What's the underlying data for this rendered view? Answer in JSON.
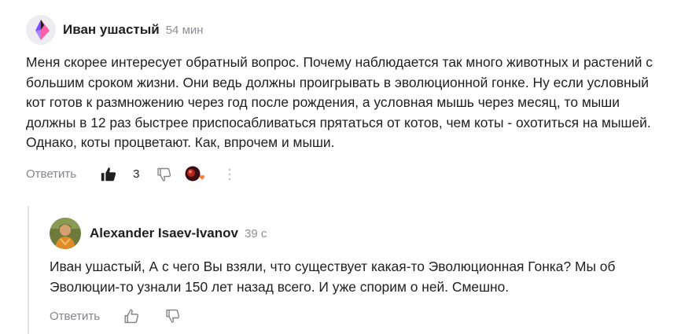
{
  "comment": {
    "author": "Иван ушастый",
    "time": "54 мин",
    "text": "Меня скорее интересует обратный вопрос. Почему наблюдается так много животных и растений с большим сроком жизни. Они ведь должны проигрывать в эволюционной гонке. Ну если условный кот готов к размножению через год после рождения, а условная мышь через месяц, то мыши должны в 12 раз быстрее приспосабливаться прятаться от котов, чем коты - охотиться на мышей. Однако, коты процветают. Как, впрочем и мыши.",
    "reply_label": "Ответить",
    "like_count": "3",
    "icons": {
      "like": "thumbs-up-filled-icon",
      "dislike": "thumbs-down-icon",
      "reactions": "reactions-icon",
      "more": "more-vertical-icon"
    }
  },
  "reply": {
    "author": "Alexander Isaev-Ivanov",
    "time": "39 с",
    "text": "Иван ушастый, А с чего Вы взяли, что существует какая-то Эволюционная Гонка? Мы об Эволюции-то узнали 150 лет назад всего. И уже спорим о ней. Смешно.",
    "reply_label": "Ответить",
    "icons": {
      "like": "thumbs-up-icon",
      "dislike": "thumbs-down-icon"
    }
  },
  "colors": {
    "text": "#1f1f1f",
    "muted": "#85858b",
    "thread_line": "#e6e6ea",
    "avatar_accent_purple": "#7b4bff",
    "avatar_accent_pink": "#ff5fa8",
    "reaction_red": "#e0443c"
  }
}
